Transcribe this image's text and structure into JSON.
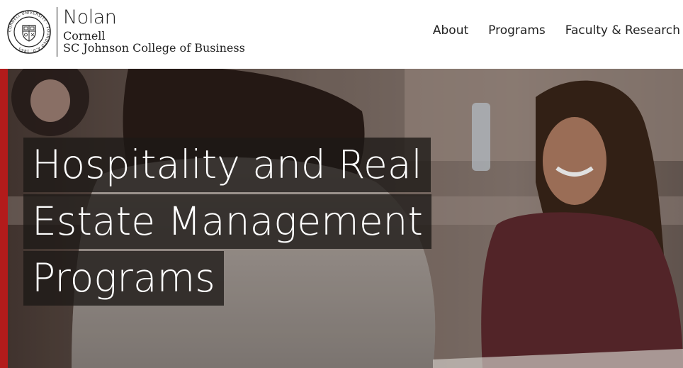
{
  "brand": {
    "seal_text": "CORNELL UNIVERSITY · FOUNDED A.D. 1865",
    "name": "Nolan",
    "line1": "Cornell",
    "line2": "SC Johnson College of Business"
  },
  "nav": {
    "items": [
      {
        "label": "About"
      },
      {
        "label": "Programs"
      },
      {
        "label": "Faculty & Research"
      }
    ]
  },
  "hero": {
    "headline_lines": [
      "Hospitality and Real",
      "Estate Management",
      "Programs"
    ]
  },
  "colors": {
    "accent": "#b31b1b",
    "text": "#222222",
    "headline_bg": "#1c1816"
  }
}
